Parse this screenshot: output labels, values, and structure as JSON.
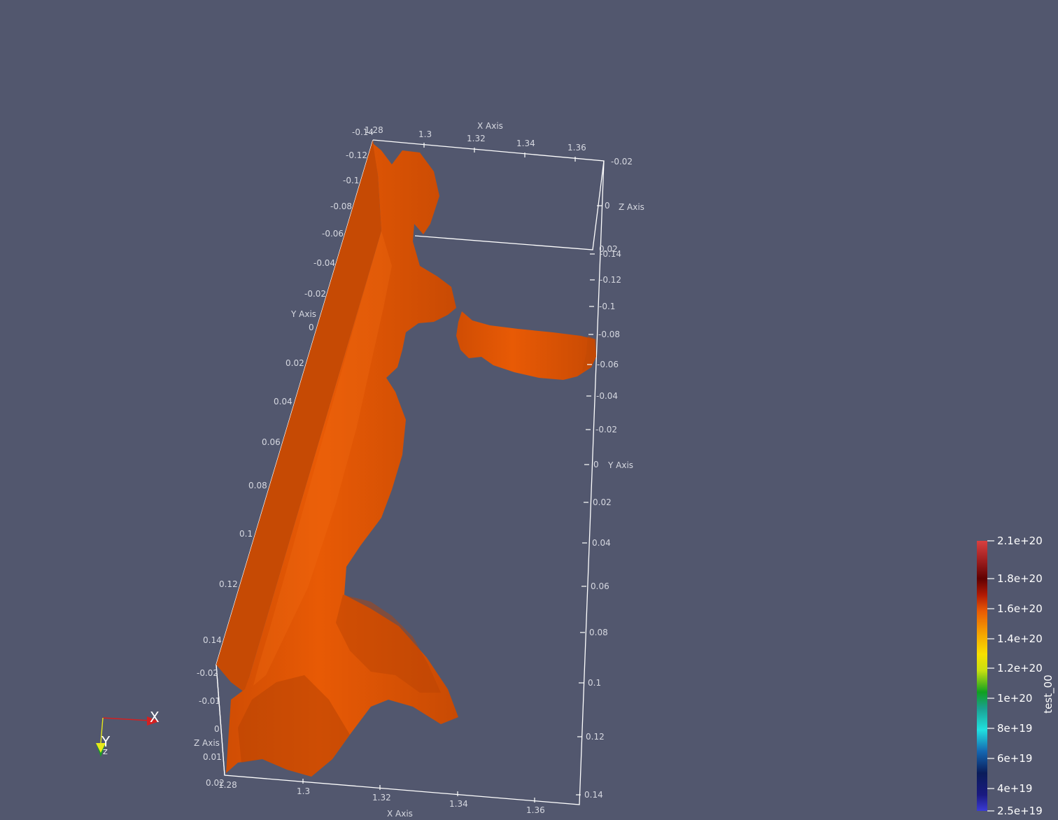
{
  "scene": {
    "background": "#52576e",
    "surface_color": "#e85a05",
    "grid_axes": {
      "x_axis_title": "X Axis",
      "y_axis_title": "Y Axis",
      "z_axis_title": "Z Axis",
      "x_ticks": [
        "1.28",
        "1.3",
        "1.32",
        "1.34",
        "1.36"
      ],
      "y_ticks_left": [
        "-0.14",
        "-0.12",
        "-0.1",
        "-0.08",
        "-0.06",
        "-0.04",
        "-0.02",
        "0",
        "0.02",
        "0.04",
        "0.06",
        "0.08",
        "0.1",
        "0.12",
        "0.14"
      ],
      "y_ticks_right": [
        "-0.14",
        "-0.12",
        "-0.1",
        "-0.08",
        "-0.06",
        "-0.04",
        "-0.02",
        "0",
        "0.02",
        "0.04",
        "0.06",
        "0.08",
        "0.1",
        "0.12",
        "0.14"
      ],
      "z_ticks_left": [
        "-0.02",
        "-0.01",
        "0",
        "0.01",
        "0.02"
      ],
      "z_ticks_right": [
        "-0.02",
        "0",
        "0.02"
      ]
    },
    "orientation_axes": {
      "x_label": "X",
      "y_label": "Y",
      "z_label": "Z",
      "x_color": "#d42020",
      "y_color": "#e8e81a",
      "z_color": "#1a9a2a"
    },
    "color_legend": {
      "title": "test_00",
      "labels": [
        "2.1e+20",
        "1.8e+20",
        "1.6e+20",
        "1.4e+20",
        "1.2e+20",
        "1e+20",
        "8e+19",
        "6e+19",
        "4e+19",
        "2.5e+19"
      ]
    }
  }
}
